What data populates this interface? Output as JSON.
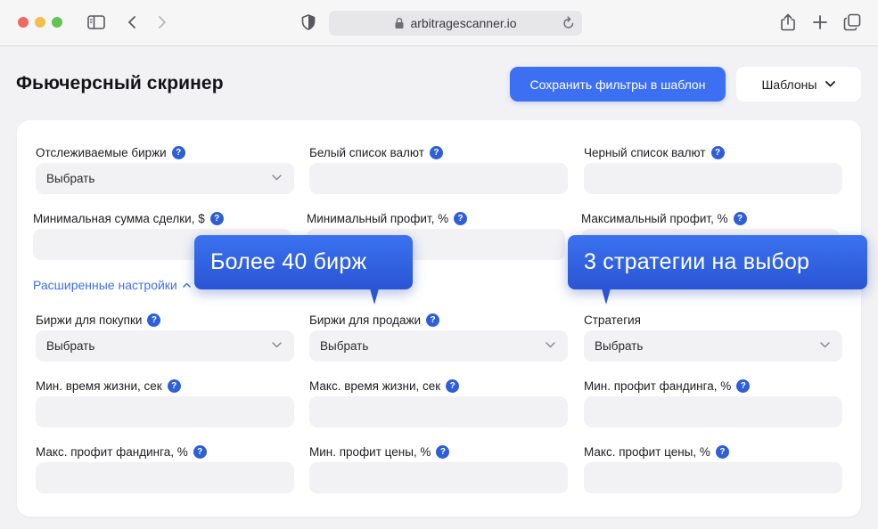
{
  "browser": {
    "url": "arbitragescanner.io"
  },
  "header": {
    "title": "Фьючерсный скринер",
    "save_button": "Сохранить фильтры в шаблон",
    "templates_button": "Шаблоны"
  },
  "filters": [
    {
      "label": "Отслеживаемые биржи",
      "value": "Выбрать",
      "type": "select"
    },
    {
      "label": "Белый список валют",
      "value": "",
      "type": "input"
    },
    {
      "label": "Черный список валют",
      "value": "",
      "type": "input"
    },
    {
      "label": "Минимальная сумма сделки, $",
      "value": "",
      "type": "input"
    },
    {
      "label": "Минимальный профит, %",
      "value": "",
      "type": "input"
    },
    {
      "label": "Максимальный профит, %",
      "value": "",
      "type": "input"
    }
  ],
  "advanced_link": "Расширенные настройки",
  "advanced_filters": [
    {
      "label": "Биржи для покупки",
      "value": "Выбрать",
      "type": "select"
    },
    {
      "label": "Биржи для продажи",
      "value": "Выбрать",
      "type": "select"
    },
    {
      "label": "Стратегия",
      "value": "Выбрать",
      "type": "select"
    },
    {
      "label": "Мин. время жизни, сек",
      "value": "",
      "type": "input"
    },
    {
      "label": "Макс. время жизни, сек",
      "value": "",
      "type": "input"
    },
    {
      "label": "Мин. профит фандинга, %",
      "value": "",
      "type": "input"
    },
    {
      "label": "Макс. профит фандинга, %",
      "value": "",
      "type": "input"
    },
    {
      "label": "Мин. профит цены, %",
      "value": "",
      "type": "input"
    },
    {
      "label": "Макс. профит цены, %",
      "value": "",
      "type": "input"
    }
  ],
  "help_glyph": "?",
  "callouts": {
    "exchanges": "Более 40 бирж",
    "strategies": "3 стратегии на выбор"
  },
  "colors": {
    "accent": "#3d6ff2",
    "help_badge": "#2f5fd6",
    "input_bg": "#f2f2f4",
    "callout": "#2f5fd6"
  }
}
